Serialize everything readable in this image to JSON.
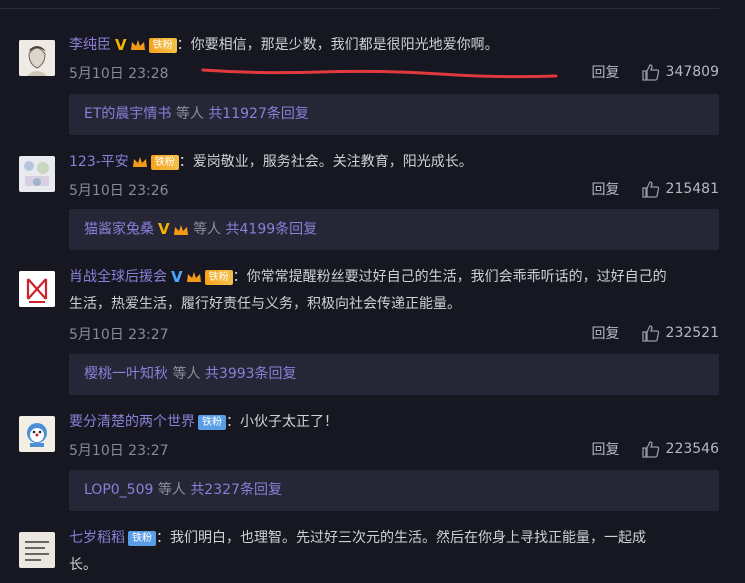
{
  "comments": [
    {
      "user": "李纯臣",
      "verified": "gold",
      "badge": "铁粉",
      "badge_style": "gold",
      "text": "：你要相信，那是少数，我们都是很阳光地爱你啊。",
      "time": "5月10日 23:28",
      "reply_label": "回复",
      "likes": "347809",
      "sub": {
        "user": "ET的晨宇情书",
        "extra": "等人",
        "count": "共11927条回复"
      }
    },
    {
      "user": "123-平安",
      "verified": "",
      "badge": "铁粉",
      "badge_style": "gold",
      "text": "：爱岗敬业，服务社会。关注教育，阳光成长。",
      "time": "5月10日 23:26",
      "reply_label": "回复",
      "likes": "215481",
      "sub": {
        "user": "猫酱家兔桑",
        "extra": "等人",
        "count": "共4199条回复"
      }
    },
    {
      "user": "肖战全球后援会",
      "verified": "blue",
      "badge": "铁粉",
      "badge_style": "gold",
      "text": "：你常常提醒粉丝要过好自己的生活，我们会乖乖听话的，过好自己的",
      "text2": "生活，热爱生活，履行好责任与义务，积极向社会传递正能量。",
      "time": "5月10日 23:27",
      "reply_label": "回复",
      "likes": "232521",
      "sub": {
        "user": "樱桃一叶知秋",
        "extra": "等人",
        "count": "共3993条回复"
      }
    },
    {
      "user": "要分清楚的两个世界",
      "verified": "",
      "badge": "铁粉",
      "badge_style": "blue",
      "text": "：小伙子太正了！",
      "time": "5月10日 23:27",
      "reply_label": "回复",
      "likes": "223546",
      "sub": {
        "user": "LOP0_509",
        "extra": "等人",
        "count": "共2327条回复"
      }
    },
    {
      "user": "七岁稻稻",
      "verified": "",
      "badge": "铁粉",
      "badge_style": "blue",
      "text": "：我们明白，也理智。先过好三次元的生活。然后在你身上寻找正能量，一起成",
      "text2": "长。"
    }
  ],
  "colors": {
    "background": "#171722",
    "username": "#8b7fd8",
    "sub_bg": "#262637",
    "annotation": "#e0393e"
  }
}
